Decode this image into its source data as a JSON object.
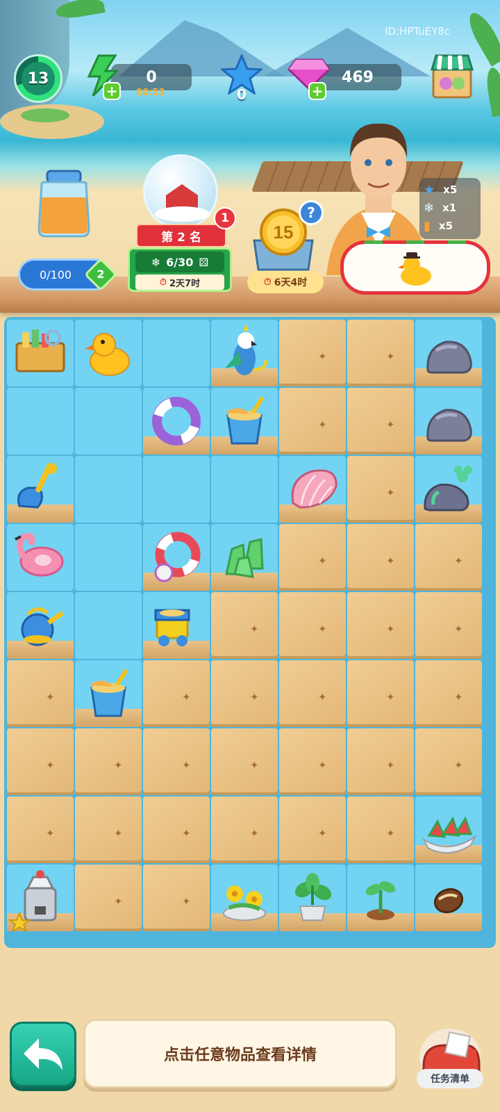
{
  "hud": {
    "player_id": "ID:HPTuEY8c",
    "level": "13",
    "energy": "0",
    "energy_timer": "00:53",
    "stars": "0",
    "gems": "469"
  },
  "jar": {
    "progress": "0/100",
    "level_badge": "2"
  },
  "event": {
    "rank_label": "第 2 名",
    "notification_count": "1",
    "progress": "6/30",
    "time_left": "2天7时"
  },
  "coin_box": {
    "coin_value": "15",
    "time_left": "6天4时",
    "help": "?"
  },
  "rewards": [
    {
      "icon": "blue-star",
      "label": "x5"
    },
    {
      "icon": "snowflake",
      "label": "x1"
    },
    {
      "icon": "juice-jar",
      "label": "x5"
    }
  ],
  "board": {
    "rows": [
      [
        "toolbox",
        "duck",
        "empty",
        "parrot",
        "sand",
        "sand",
        "rock"
      ],
      [
        "empty",
        "empty",
        "swim-ring-purple",
        "sand-bucket",
        "sand",
        "sand",
        "rock"
      ],
      [
        "shovel",
        "empty",
        "empty",
        "empty",
        "seashell",
        "sand",
        "rock-plant"
      ],
      [
        "flamingo-float",
        "empty",
        "swim-ring-red",
        "cactus",
        "sand",
        "sand",
        "sand"
      ],
      [
        "watering-can",
        "empty",
        "sand-truck",
        "sand",
        "sand",
        "sand",
        "sand"
      ],
      [
        "sand",
        "sand-bucket",
        "sand",
        "sand",
        "sand",
        "sand",
        "sand"
      ],
      [
        "sand",
        "sand",
        "sand",
        "sand",
        "sand",
        "sand",
        "sand"
      ],
      [
        "sand",
        "sand",
        "sand",
        "sand",
        "sand",
        "sand",
        "watermelon"
      ],
      [
        "juicer",
        "sand",
        "sand",
        "yellow-flowers",
        "potted-plant",
        "sprout",
        "seed"
      ]
    ]
  },
  "hint": "点击任意物品查看详情",
  "task_list_label": "任务清单",
  "colors": {
    "board": "#4fb5dc",
    "tile": "#73d3f2",
    "sand": "#e2b776",
    "accent": "#16a686"
  }
}
